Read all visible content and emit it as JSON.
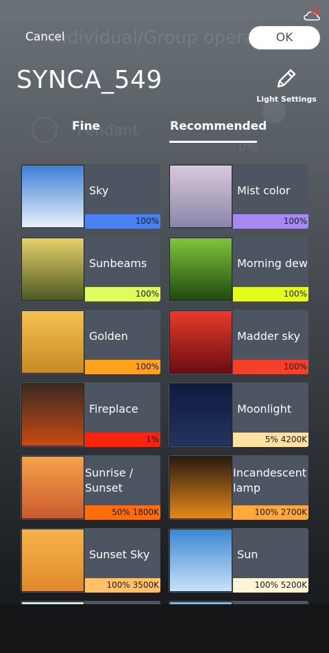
{
  "header": {
    "cancel_label": "Cancel",
    "ok_label": "OK",
    "device_name": "SYNCA_549",
    "light_settings_label": "Light Settings",
    "ghost_title": "Individual/Group opera",
    "ghost_subtitle": "Pendant",
    "ghost_percent": "0%"
  },
  "tabs": [
    {
      "label": "Fine",
      "active": false
    },
    {
      "label": "Recommended",
      "active": true
    }
  ],
  "scenes": [
    {
      "name": "Sky",
      "status": "100%",
      "bar_color": "#4a80f0",
      "thumb": [
        "#3f7fd6",
        "#e8f1fb"
      ]
    },
    {
      "name": "Mist color",
      "status": "100%",
      "bar_color": "#a58af0",
      "thumb": [
        "#d9c8dd",
        "#8a86a8"
      ]
    },
    {
      "name": "Sunbeams",
      "status": "100%",
      "bar_color": "#dcfc60",
      "thumb": [
        "#e8d06a",
        "#4d5a24"
      ]
    },
    {
      "name": "Morning dew",
      "status": "100%",
      "bar_color": "#e4fc1c",
      "thumb": [
        "#7fc53a",
        "#1f4a12"
      ]
    },
    {
      "name": "Golden",
      "status": "100%",
      "bar_color": "#ffa21e",
      "thumb": [
        "#f5c053",
        "#c88a24"
      ]
    },
    {
      "name": "Madder sky",
      "status": "100%",
      "bar_color": "#f4412c",
      "thumb": [
        "#e83a2a",
        "#6b0d12"
      ]
    },
    {
      "name": "Fireplace",
      "status": "1%",
      "bar_color": "#f82410",
      "thumb": [
        "#3b2a22",
        "#c84a12"
      ]
    },
    {
      "name": "Moonlight",
      "status": "5% 4200K",
      "bar_color": "#ffe1a4",
      "thumb": [
        "#0e1a40",
        "#23345e"
      ]
    },
    {
      "name": "Sunrise / Sunset",
      "status": "50% 1800K",
      "bar_color": "#ff6e0a",
      "thumb": [
        "#f6a24a",
        "#c95a2e"
      ]
    },
    {
      "name": "Incandescent lamp",
      "status": "100% 2700K",
      "bar_color": "#ffa83c",
      "thumb": [
        "#2a1a10",
        "#e5891a"
      ]
    },
    {
      "name": "Sunset Sky",
      "status": "100% 3500K",
      "bar_color": "#ffc26a",
      "thumb": [
        "#f7b24a",
        "#e08a2a"
      ]
    },
    {
      "name": "Sun",
      "status": "100% 5200K",
      "bar_color": "#fff4d6",
      "thumb": [
        "#3c86d4",
        "#c9e2f8"
      ]
    },
    {
      "name": "",
      "status": "",
      "bar_color": "#4d5563",
      "thumb": [
        "#cfe4f2",
        "#9cc4de"
      ]
    },
    {
      "name": "",
      "status": "",
      "bar_color": "#4d5563",
      "thumb": [
        "#5cc6f0",
        "#a9e2fa"
      ]
    }
  ],
  "icons": [
    "cloud-alert-icon",
    "pencil-icon"
  ]
}
